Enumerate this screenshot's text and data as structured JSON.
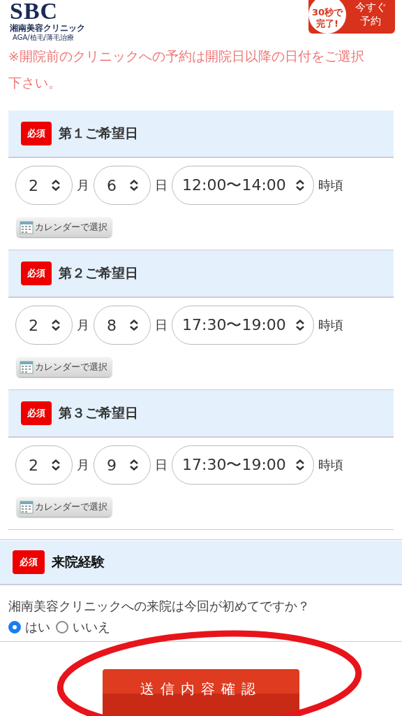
{
  "header": {
    "logo": "SBC",
    "clinic_name": "湘南美容クリニック",
    "tagline": "AGA/植毛/薄毛治療",
    "badge_lines": [
      "30秒で",
      "完了!"
    ],
    "reserve_lines": [
      "今すぐ",
      "予約"
    ]
  },
  "notice": "※開院前のクリニックへの予約は開院日以降の日付をご選択下さい。",
  "date_sections": [
    {
      "required": "必須",
      "title": "第１ご希望日",
      "month": "2",
      "month_unit": "月",
      "day": "6",
      "day_unit": "日",
      "time": "12:00〜14:00",
      "time_unit": "時頃",
      "calendar_button": "カレンダーで選択"
    },
    {
      "required": "必須",
      "title": "第２ご希望日",
      "month": "2",
      "month_unit": "月",
      "day": "8",
      "day_unit": "日",
      "time": "17:30〜19:00",
      "time_unit": "時頃",
      "calendar_button": "カレンダーで選択"
    },
    {
      "required": "必須",
      "title": "第３ご希望日",
      "month": "2",
      "month_unit": "月",
      "day": "9",
      "day_unit": "日",
      "time": "17:30〜19:00",
      "time_unit": "時頃",
      "calendar_button": "カレンダーで選択"
    }
  ],
  "visit_section": {
    "required": "必須",
    "title": "来院経験",
    "question": "湘南美容クリニックへの来院は今回が初めてですか？",
    "options": [
      {
        "label": "はい",
        "selected": true
      },
      {
        "label": "いいえ",
        "selected": false
      }
    ]
  },
  "submit_button": "送信内容確認"
}
